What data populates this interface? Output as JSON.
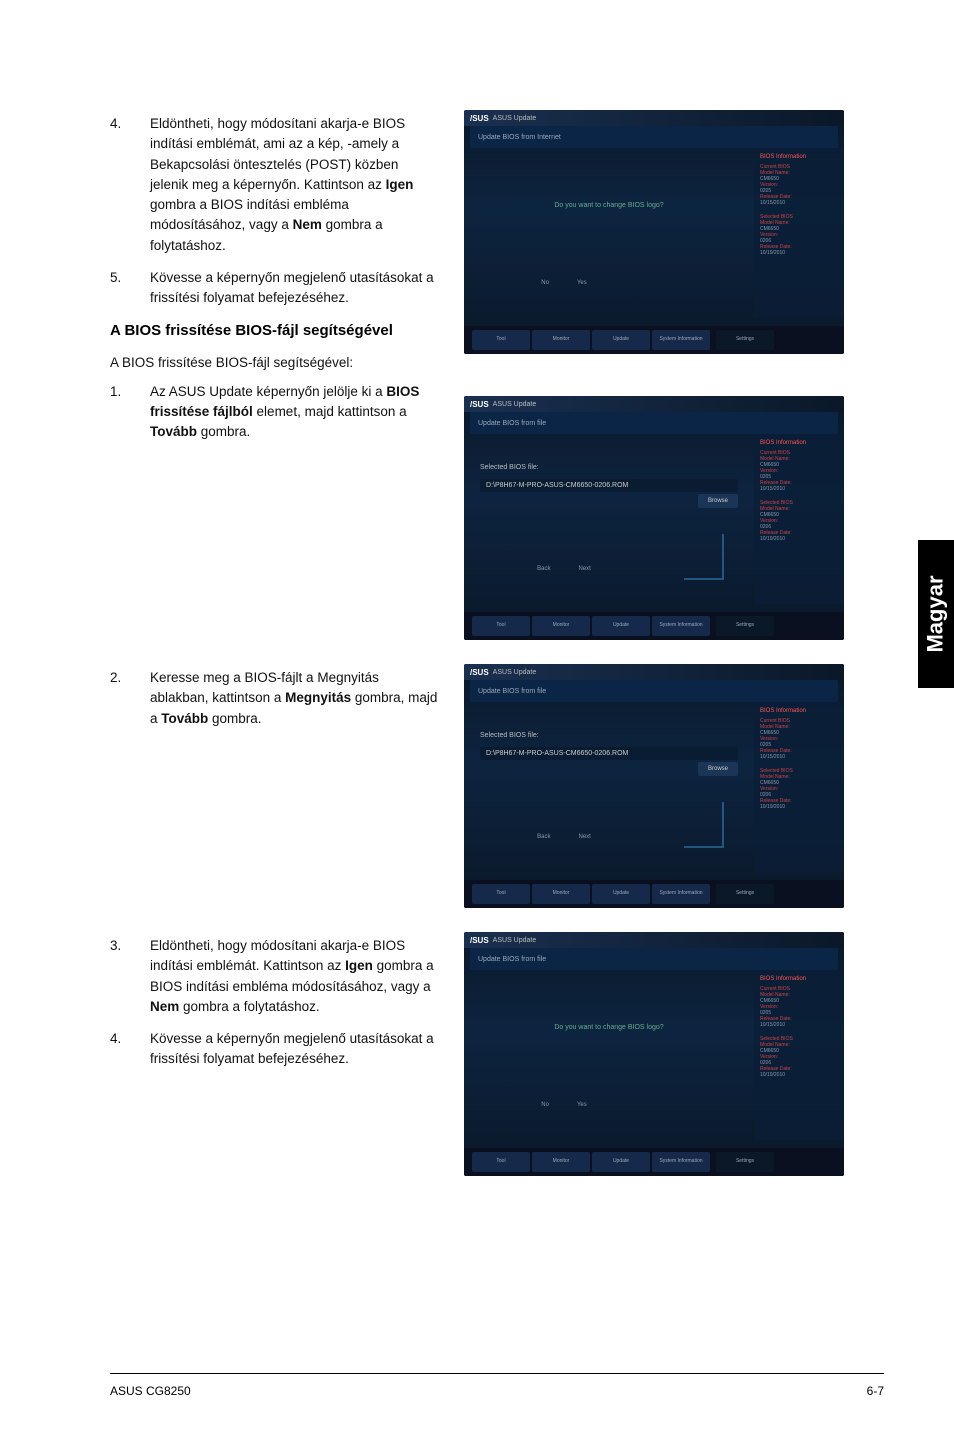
{
  "side_tab": "Magyar",
  "footer": {
    "left": "ASUS CG8250",
    "right": "6-7"
  },
  "sections": {
    "s4a": {
      "num": "4.",
      "body_parts": [
        "Eldöntheti, hogy módosítani akarja-e BIOS indítási emblémát, ami az a kép, -amely a Bekapcsolási öntesztelés (POST) közben jelenik meg a képernyőn. Kattintson az ",
        "Igen",
        " gombra a BIOS indítási embléma módosításához, vagy a ",
        "Nem",
        " gombra a folytatáshoz."
      ]
    },
    "s5a": {
      "num": "5.",
      "body": "Kövesse a képernyőn megjelenő utasításokat a frissítési folyamat befejezéséhez."
    },
    "heading": "A BIOS frissítése BIOS-fájl segítségével",
    "intro": "A BIOS frissítése BIOS-fájl segítségével:",
    "s1b": {
      "num": "1.",
      "body_parts": [
        "Az ASUS Update képernyőn jelölje ki a ",
        "BIOS frissítése fájlból",
        " elemet, majd kattintson a ",
        "Tovább",
        " gombra."
      ]
    },
    "s2b": {
      "num": "2.",
      "body_parts": [
        "Keresse meg a BIOS-fájlt a Megnyitás ablakban, kattintson a ",
        "Megnyitás",
        " gombra, majd a ",
        "Tovább",
        " gombra."
      ]
    },
    "s3b": {
      "num": "3.",
      "body_parts": [
        "Eldöntheti, hogy módosítani akarja-e BIOS indítási emblémát. Kattintson az ",
        "Igen",
        " gombra a BIOS indítási embléma módosításához, vagy a ",
        "Nem",
        " gombra a folytatáshoz."
      ]
    },
    "s4b": {
      "num": "4.",
      "body": "Kövesse a képernyőn megjelenő utasításokat a frissítési folyamat befejezéséhez."
    }
  },
  "screenshots": {
    "ss1": {
      "logo": "/SUS",
      "title": "ASUS Update",
      "header": "Update BIOS from Internet",
      "prompt": "Do you want to change BIOS logo?",
      "nav_no": "No",
      "nav_yes": "Yes",
      "side_title": "BIOS Information",
      "side": {
        "g1_label": "Current BIOS",
        "g1_model": "Model Name:",
        "g1_model_v": "CM6650",
        "g1_ver": "Version:",
        "g1_ver_v": "0205",
        "g1_date": "Release Date:",
        "g1_date_v": "10/15/2010",
        "g2_label": "Selected BIOS",
        "g2_model": "Model Name:",
        "g2_model_v": "CM6650",
        "g2_ver": "Version:",
        "g2_ver_v": "0206",
        "g2_date": "Release Date:",
        "g2_date_v": "10/19/2010"
      },
      "tabs": {
        "t1": "Tool",
        "t2": "Monitor",
        "t3": "Update",
        "t4": "System\nInformation",
        "t5": "Settings"
      }
    },
    "ss2": {
      "logo": "/SUS",
      "title": "ASUS Update",
      "header": "Update BIOS from file",
      "filelabel": "Selected BIOS file:",
      "filepath": "D:\\P8H67-M-PRO-ASUS-CM6650-0206.ROM",
      "browse": "Browse",
      "nav_back": "Back",
      "nav_next": "Next",
      "side_title": "BIOS Information",
      "side": {
        "g1_label": "Current BIOS",
        "g1_model": "Model Name:",
        "g1_model_v": "CM6650",
        "g1_ver": "Version:",
        "g1_ver_v": "0205",
        "g1_date": "Release Date:",
        "g1_date_v": "10/15/2010",
        "g2_label": "Selected BIOS",
        "g2_model": "Model Name:",
        "g2_model_v": "CM6650",
        "g2_ver": "Version:",
        "g2_ver_v": "0206",
        "g2_date": "Release Date:",
        "g2_date_v": "10/19/2010"
      },
      "tabs": {
        "t1": "Tool",
        "t2": "Monitor",
        "t3": "Update",
        "t4": "System\nInformation",
        "t5": "Settings"
      }
    },
    "ss3": {
      "logo": "/SUS",
      "title": "ASUS Update",
      "header": "Update BIOS from file",
      "filelabel": "Selected BIOS file:",
      "filepath": "D:\\P8H67-M-PRO-ASUS-CM6650-0206.ROM",
      "browse": "Browse",
      "nav_back": "Back",
      "nav_next": "Next",
      "side_title": "BIOS Information",
      "side": {
        "g1_label": "Current BIOS",
        "g1_model": "Model Name:",
        "g1_model_v": "CM6650",
        "g1_ver": "Version:",
        "g1_ver_v": "0205",
        "g1_date": "Release Date:",
        "g1_date_v": "10/15/2010",
        "g2_label": "Selected BIOS",
        "g2_model": "Model Name:",
        "g2_model_v": "CM6650",
        "g2_ver": "Version:",
        "g2_ver_v": "0206",
        "g2_date": "Release Date:",
        "g2_date_v": "10/19/2010"
      },
      "tabs": {
        "t1": "Tool",
        "t2": "Monitor",
        "t3": "Update",
        "t4": "System\nInformation",
        "t5": "Settings"
      }
    },
    "ss4": {
      "logo": "/SUS",
      "title": "ASUS Update",
      "header": "Update BIOS from file",
      "prompt": "Do you want to change BIOS logo?",
      "nav_no": "No",
      "nav_yes": "Yes",
      "side_title": "BIOS Information",
      "side": {
        "g1_label": "Current BIOS",
        "g1_model": "Model Name:",
        "g1_model_v": "CM6650",
        "g1_ver": "Version:",
        "g1_ver_v": "0205",
        "g1_date": "Release Date:",
        "g1_date_v": "10/15/2010",
        "g2_label": "Selected BIOS",
        "g2_model": "Model Name:",
        "g2_model_v": "CM6650",
        "g2_ver": "Version:",
        "g2_ver_v": "0206",
        "g2_date": "Release Date:",
        "g2_date_v": "10/19/2010"
      },
      "tabs": {
        "t1": "Tool",
        "t2": "Monitor",
        "t3": "Update",
        "t4": "System\nInformation",
        "t5": "Settings"
      }
    }
  }
}
